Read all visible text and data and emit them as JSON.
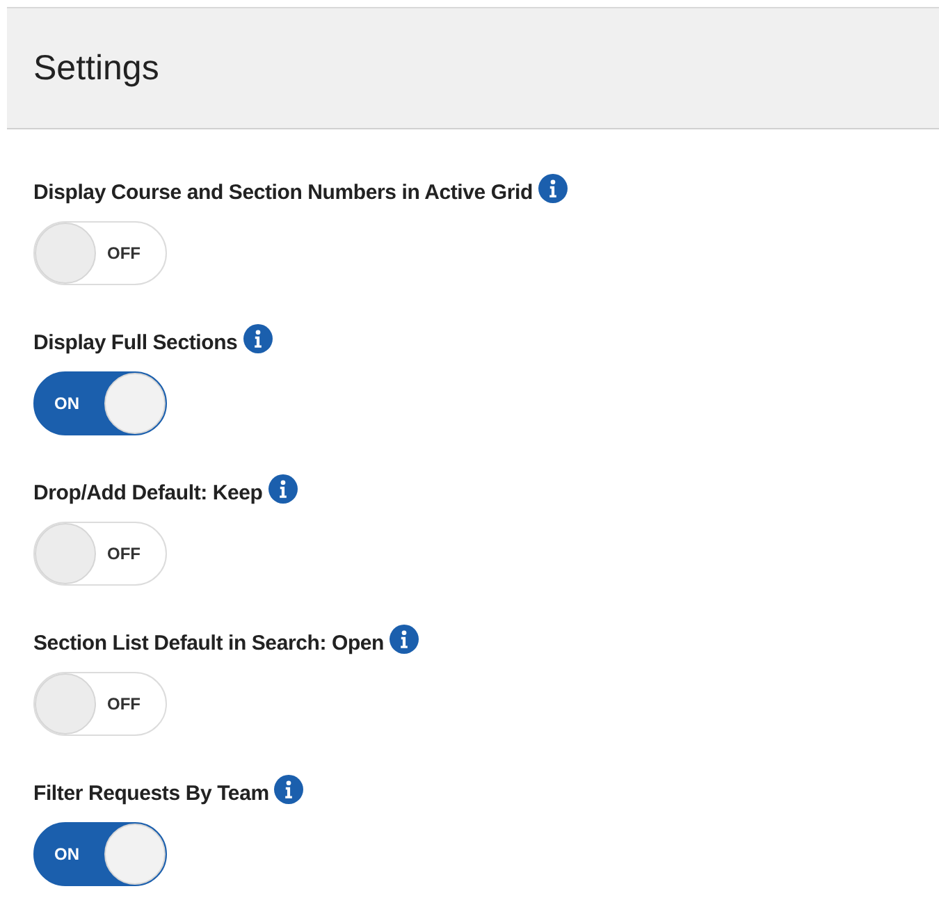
{
  "header": {
    "title": "Settings"
  },
  "settings": [
    {
      "label": "Display Course and Section Numbers in Active Grid",
      "on": false,
      "state_text": "OFF"
    },
    {
      "label": "Display Full Sections",
      "on": true,
      "state_text": "ON"
    },
    {
      "label": "Drop/Add Default: Keep",
      "on": false,
      "state_text": "OFF"
    },
    {
      "label": "Section List Default in Search: Open",
      "on": false,
      "state_text": "OFF"
    },
    {
      "label": "Filter Requests By Team",
      "on": true,
      "state_text": "ON"
    }
  ]
}
